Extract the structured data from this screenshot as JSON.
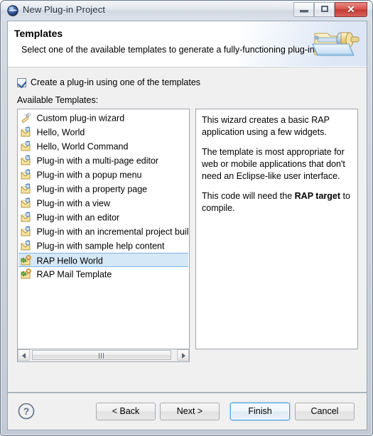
{
  "window": {
    "title": "New Plug-in Project",
    "icon": "eclipse-sphere-icon",
    "controls": {
      "minimize": "—",
      "maximize": "□",
      "close": "✕"
    }
  },
  "header": {
    "title": "Templates",
    "description": "Select one of the available templates to generate a fully-functioning plug-in.",
    "banner_icon": "folder-plug-banner-icon"
  },
  "options": {
    "use_template_checkbox": {
      "label": "Create a plug-in using one of the templates",
      "checked": true
    },
    "available_templates_label": "Available Templates:"
  },
  "template_list": {
    "selected_index": 10,
    "items": [
      {
        "label": "Custom plug-in wizard",
        "icon": "wizard-wand-icon"
      },
      {
        "label": "Hello, World",
        "icon": "plugin-template-icon"
      },
      {
        "label": "Hello, World Command",
        "icon": "plugin-template-icon"
      },
      {
        "label": "Plug-in with a multi-page editor",
        "icon": "plugin-template-icon"
      },
      {
        "label": "Plug-in with a popup menu",
        "icon": "plugin-template-icon"
      },
      {
        "label": "Plug-in with a property page",
        "icon": "plugin-template-icon"
      },
      {
        "label": "Plug-in with a view",
        "icon": "plugin-template-icon"
      },
      {
        "label": "Plug-in with an editor",
        "icon": "plugin-template-icon"
      },
      {
        "label": "Plug-in with an incremental project build",
        "icon": "plugin-template-icon"
      },
      {
        "label": "Plug-in with sample help content",
        "icon": "plugin-template-icon"
      },
      {
        "label": "RAP Hello World",
        "icon": "rap-template-icon"
      },
      {
        "label": "RAP Mail Template",
        "icon": "rap-template-icon"
      }
    ]
  },
  "description_panel": {
    "paragraphs": [
      {
        "text": "This wizard creates a basic RAP application using a few widgets."
      },
      {
        "text": "The template is most appropriate for web or mobile applications that don't need an Eclipse-like user interface."
      },
      {
        "before": "This code will need the ",
        "bold": "RAP target",
        "after": " to compile."
      }
    ]
  },
  "buttons": {
    "help": "?",
    "back": "< Back",
    "next": "Next >",
    "finish": "Finish",
    "cancel": "Cancel",
    "default_button": "Finish"
  },
  "colors": {
    "selection_fill": "#d4e8f7",
    "selection_border": "#7eb4ea",
    "focus_border": "#3c9ade",
    "close_button": "#c43a33",
    "dialog_background": "#f0f0f0"
  }
}
